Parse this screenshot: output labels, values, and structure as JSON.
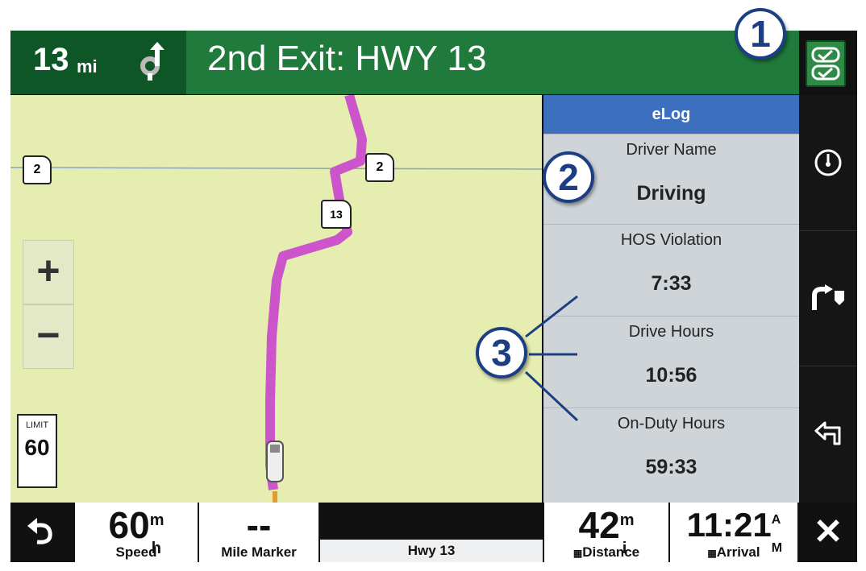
{
  "nav": {
    "distance": "13",
    "distance_unit": "mi",
    "turn_icon": "roundabout-exit-icon",
    "instruction": "2nd Exit: HWY 13"
  },
  "map": {
    "zoom_in": "+",
    "zoom_out": "−",
    "route_shields": [
      "2",
      "2",
      "13"
    ],
    "speed_limit_label": "LIMIT",
    "speed_limit_value": "60"
  },
  "elog": {
    "title": "eLog",
    "driver_name": "Driver Name",
    "status": "Driving",
    "rows": [
      {
        "label": "HOS Violation",
        "value": "7:33"
      },
      {
        "label": "Drive Hours",
        "value": "10:56"
      },
      {
        "label": "On-Duty Hours",
        "value": "59:33"
      }
    ]
  },
  "sidebar": {
    "items": [
      "speedometer-icon",
      "next-turn-icon",
      "turn-list-icon"
    ]
  },
  "bottom": {
    "speed_value": "60",
    "speed_unit_top": "m",
    "speed_unit_bottom": "h",
    "speed_label": "Speed",
    "mile_marker_value": "--",
    "mile_marker_label": "Mile Marker",
    "street": "Hwy 13",
    "distance_value": "42",
    "distance_unit_top": "m",
    "distance_unit_bottom": "i",
    "distance_label": "Distance",
    "arrival_value": "11:21",
    "arrival_unit_top": "A",
    "arrival_unit_bottom": "M",
    "arrival_label": "Arrival",
    "close": "✕"
  },
  "callouts": [
    "1",
    "2",
    "3"
  ],
  "colors": {
    "nav_green": "#1f7a3c",
    "route_magenta": "#cc55cc",
    "elog_blue": "#3d6fbf",
    "callout_blue": "#1b3f82"
  }
}
